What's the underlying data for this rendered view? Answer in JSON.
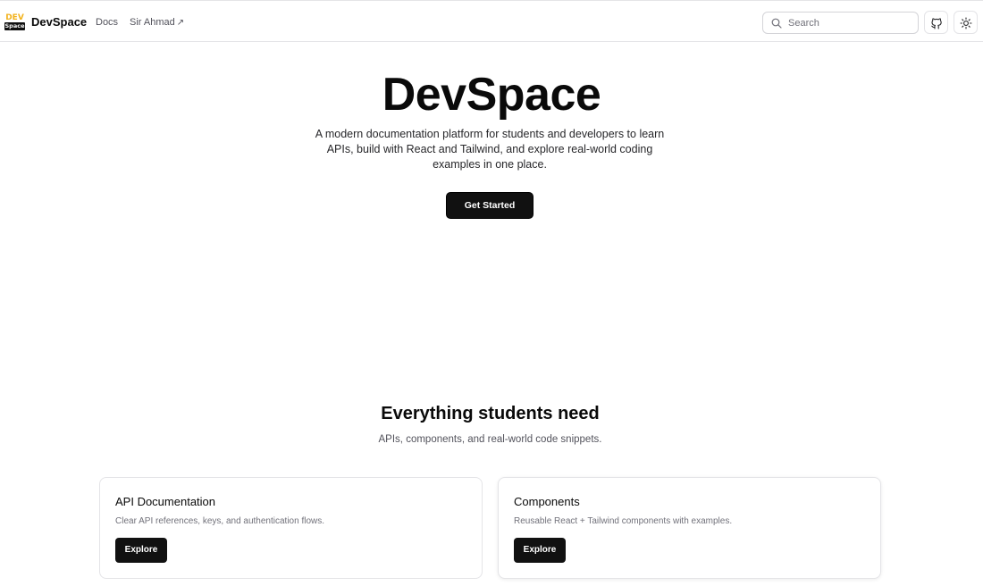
{
  "header": {
    "logo_top": "DEV",
    "logo_bottom": "Space",
    "brand": "DevSpace",
    "nav": [
      {
        "label": "Docs"
      },
      {
        "label": "Sir Ahmad",
        "external_icon": "arrow-up-right-icon"
      }
    ],
    "search": {
      "placeholder": "Search",
      "icon": "search-icon"
    },
    "github_icon": "github-icon",
    "theme_icon": "sun-icon"
  },
  "hero": {
    "title": "DevSpace",
    "subtitle": "A modern documentation platform for students and developers to learn APIs, build with React and Tailwind, and explore real-world coding examples in one place.",
    "cta_label": "Get Started"
  },
  "features": {
    "title": "Everything students need",
    "subtitle": "APIs, components, and real-world code snippets.",
    "cards": [
      {
        "title": "API Documentation",
        "description": "Clear API references, keys, and authentication flows.",
        "button": "Explore"
      },
      {
        "title": "Components",
        "description": "Reusable React + Tailwind components with examples.",
        "button": "Explore"
      }
    ]
  },
  "colors": {
    "accent": "#111111",
    "logo_yellow": "#f2b21c",
    "muted_text": "#71717a",
    "border": "#e4e4e7"
  }
}
